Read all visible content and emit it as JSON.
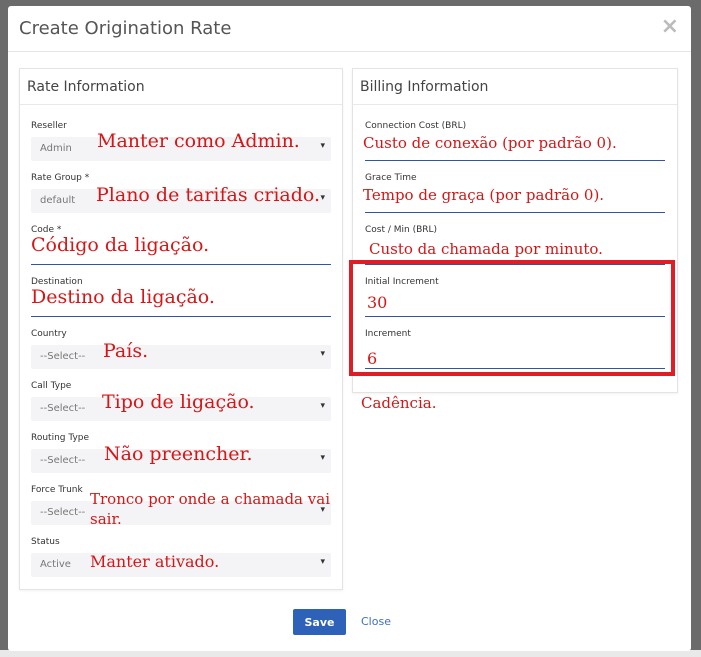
{
  "modal": {
    "title": "Create Origination Rate",
    "close_symbol": "×",
    "save_label": "Save",
    "close_label": "Close"
  },
  "rate_info": {
    "title": "Rate Information",
    "reseller": {
      "label": "Reseller",
      "value": "Admin",
      "note": "Manter como Admin."
    },
    "rate_group": {
      "label": "Rate Group *",
      "value": "default",
      "note": "Plano de tarifas criado."
    },
    "code": {
      "label": "Code *",
      "note": "Código da ligação."
    },
    "destination": {
      "label": "Destination",
      "note": "Destino da ligação."
    },
    "country": {
      "label": "Country",
      "value": "--Select--",
      "note": "País."
    },
    "call_type": {
      "label": "Call Type",
      "value": "--Select--",
      "note": "Tipo de ligação."
    },
    "routing_type": {
      "label": "Routing Type",
      "value": "--Select--",
      "note": "Não preencher."
    },
    "force_trunk": {
      "label": "Force Trunk",
      "value": "--Select--",
      "note_line1": "Tronco por onde a chamada vai",
      "note_line2": "sair."
    },
    "status": {
      "label": "Status",
      "value": "Active",
      "note": "Manter ativado."
    }
  },
  "billing_info": {
    "title": "Billing Information",
    "connection_cost": {
      "label": "Connection Cost (BRL)",
      "note": "Custo de conexão (por padrão 0)."
    },
    "grace_time": {
      "label": "Grace Time",
      "note": "Tempo de graça (por padrão 0)."
    },
    "cost_min": {
      "label": "Cost / Min (BRL)",
      "note": "Custo da chamada por minuto."
    },
    "initial_increment": {
      "label": "Initial Increment",
      "value": "30"
    },
    "increment": {
      "label": "Increment",
      "value": "6"
    },
    "cadence_note": "Cadência."
  },
  "caret": "▾",
  "colors": {
    "annotation": "#d61616",
    "highlight_box": "#e01c24",
    "primary": "#2e62b8"
  }
}
